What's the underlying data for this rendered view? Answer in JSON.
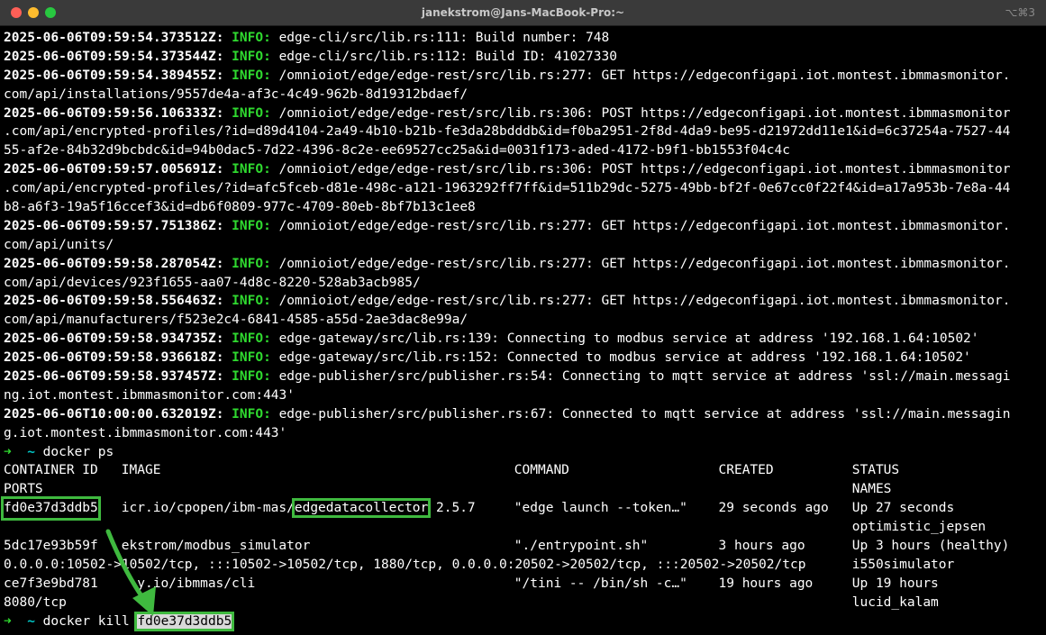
{
  "window": {
    "title": "janekstrom@Jans-MacBook-Pro:~",
    "shortcut": "⌥⌘3"
  },
  "log": [
    {
      "ts": "2025-06-06T09:59:54.373512Z:",
      "level": "INFO:",
      "msg": "edge-cli/src/lib.rs:111: Build number: 748"
    },
    {
      "ts": "2025-06-06T09:59:54.373544Z:",
      "level": "INFO:",
      "msg": "edge-cli/src/lib.rs:112: Build ID: 41027330"
    },
    {
      "ts": "2025-06-06T09:59:54.389455Z:",
      "level": "INFO:",
      "msg": "/omnioiot/edge/edge-rest/src/lib.rs:277: GET https://edgeconfigapi.iot.montest.ibmmasmonitor.",
      "cont": [
        "com/api/installations/9557de4a-af3c-4c49-962b-8d19312bdaef/"
      ]
    },
    {
      "ts": "2025-06-06T09:59:56.106333Z:",
      "level": "INFO:",
      "msg": "/omnioiot/edge/edge-rest/src/lib.rs:306: POST https://edgeconfigapi.iot.montest.ibmmasmonitor",
      "cont": [
        ".com/api/encrypted-profiles/?id=d89d4104-2a49-4b10-b21b-fe3da28bdddb&id=f0ba2951-2f8d-4da9-be95-d21972dd11e1&id=6c37254a-7527-44",
        "55-af2e-84b32d9bcbdc&id=94b0dac5-7d22-4396-8c2e-ee69527cc25a&id=0031f173-aded-4172-b9f1-bb1553f04c4c"
      ]
    },
    {
      "ts": "2025-06-06T09:59:57.005691Z:",
      "level": "INFO:",
      "msg": "/omnioiot/edge/edge-rest/src/lib.rs:306: POST https://edgeconfigapi.iot.montest.ibmmasmonitor",
      "cont": [
        ".com/api/encrypted-profiles/?id=afc5fceb-d81e-498c-a121-1963292ff7ff&id=511b29dc-5275-49bb-bf2f-0e67cc0f22f4&id=a17a953b-7e8a-44",
        "b8-a6f3-19a5f16ccef3&id=db6f0809-977c-4709-80eb-8bf7b13c1ee8"
      ]
    },
    {
      "ts": "2025-06-06T09:59:57.751386Z:",
      "level": "INFO:",
      "msg": "/omnioiot/edge/edge-rest/src/lib.rs:277: GET https://edgeconfigapi.iot.montest.ibmmasmonitor.",
      "cont": [
        "com/api/units/"
      ]
    },
    {
      "ts": "2025-06-06T09:59:58.287054Z:",
      "level": "INFO:",
      "msg": "/omnioiot/edge/edge-rest/src/lib.rs:277: GET https://edgeconfigapi.iot.montest.ibmmasmonitor.",
      "cont": [
        "com/api/devices/923f1655-aa07-4d8c-8220-528ab3acb985/"
      ]
    },
    {
      "ts": "2025-06-06T09:59:58.556463Z:",
      "level": "INFO:",
      "msg": "/omnioiot/edge/edge-rest/src/lib.rs:277: GET https://edgeconfigapi.iot.montest.ibmmasmonitor.",
      "cont": [
        "com/api/manufacturers/f523e2c4-6841-4585-a55d-2ae3dac8e99a/"
      ]
    },
    {
      "ts": "2025-06-06T09:59:58.934735Z:",
      "level": "INFO:",
      "msg": "edge-gateway/src/lib.rs:139: Connecting to modbus service at address '192.168.1.64:10502'"
    },
    {
      "ts": "2025-06-06T09:59:58.936618Z:",
      "level": "INFO:",
      "msg": "edge-gateway/src/lib.rs:152: Connected to modbus service at address '192.168.1.64:10502'"
    },
    {
      "ts": "2025-06-06T09:59:58.937457Z:",
      "level": "INFO:",
      "msg": "edge-publisher/src/publisher.rs:54: Connecting to mqtt service at address 'ssl://main.messagi",
      "cont": [
        "ng.iot.montest.ibmmasmonitor.com:443'"
      ]
    },
    {
      "ts": "2025-06-06T10:00:00.632019Z:",
      "level": "INFO:",
      "msg": "edge-publisher/src/publisher.rs:67: Connected to mqtt service at address 'ssl://main.messagin",
      "cont": [
        "g.iot.montest.ibmmasmonitor.com:443'"
      ]
    }
  ],
  "prompt": {
    "arrow": "➜",
    "dir": "~"
  },
  "cmd1": "docker ps",
  "headers": {
    "container_id": "CONTAINER ID",
    "image": "IMAGE",
    "command": "COMMAND",
    "created": "CREATED",
    "status": "STATUS",
    "ports": "PORTS",
    "names": "NAMES"
  },
  "containers": [
    {
      "id": "fd0e37d3ddb5",
      "image_prefix": "icr.io/cpopen/ibm-mas/",
      "image_name": "edgedatacollector",
      "image_tag": "2.5.7",
      "command": "\"edge launch --token…\"",
      "created": "29 seconds ago",
      "status": "Up 27 seconds",
      "ports": "",
      "names": "optimistic_jepsen"
    },
    {
      "id": "5dc17e93b59f",
      "image": "ekstrom/modbus_simulator",
      "command": "\"./entrypoint.sh\"",
      "created": "3 hours ago",
      "status": "Up 3 hours (healthy)",
      "ports": "0.0.0.0:10502->10502/tcp, :::10502->10502/tcp, 1880/tcp, 0.0.0.0:20502->20502/tcp, :::20502->20502/tcp",
      "names": "i550simulator"
    },
    {
      "id": "ce7f3e9bd781",
      "image": "  y.io/ibmmas/cli",
      "command": "\"/tini -- /bin/sh -c…\"",
      "created": "19 hours ago",
      "status": "Up 19 hours",
      "ports": "8080/tcp",
      "names": "lucid_kalam"
    }
  ],
  "cmd2": "docker kill",
  "cmd2_arg": "fd0e37d3ddb5",
  "colors": {
    "annotation": "#3fb93f",
    "info": "#2fd92f",
    "prompt_dir": "#00c8c8"
  }
}
